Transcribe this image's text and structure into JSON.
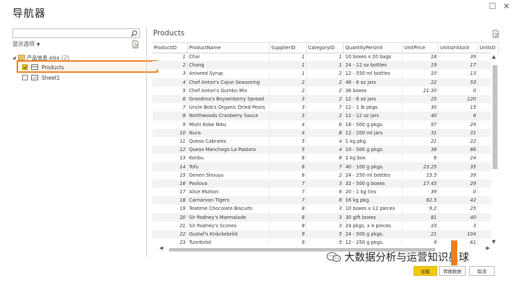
{
  "title": "导航器",
  "window_controls": {
    "maximize": "☐",
    "close": "✕"
  },
  "search": {
    "placeholder": "",
    "value": ""
  },
  "display_options": "显示选项",
  "tree": {
    "root_name": "产品信息.xlsx",
    "root_count": "[2]",
    "items": [
      {
        "label": "Products",
        "checked": true
      },
      {
        "label": "Sheet1",
        "checked": false
      }
    ]
  },
  "preview": {
    "title": "Products",
    "columns": [
      "ProductID",
      "ProductName",
      "SupplierID",
      "CategoryID",
      "QuantityPerUnit",
      "UnitPrice",
      "UnitsInStock",
      "UnitsO"
    ],
    "rows": [
      [
        "1",
        "Chai",
        "1",
        "1",
        "10 boxes x 20 bags",
        "18",
        "39"
      ],
      [
        "2",
        "Chang",
        "1",
        "1",
        "24 - 12 oz bottles",
        "19",
        "17"
      ],
      [
        "3",
        "Aniseed Syrup",
        "1",
        "2",
        "12 - 550 ml bottles",
        "10",
        "13"
      ],
      [
        "4",
        "Chef Anton's Cajun Seasoning",
        "2",
        "2",
        "48 - 6 oz jars",
        "22",
        "53"
      ],
      [
        "5",
        "Chef Anton's Gumbo Mix",
        "2",
        "2",
        "36 boxes",
        "21.35",
        "0"
      ],
      [
        "6",
        "Grandma's Boysenberry Spread",
        "3",
        "2",
        "12 - 8 oz jars",
        "25",
        "120"
      ],
      [
        "7",
        "Uncle Bob's Organic Dried Pears",
        "3",
        "7",
        "12 - 1 lb pkgs.",
        "30",
        "15"
      ],
      [
        "8",
        "Northwoods Cranberry Sauce",
        "3",
        "2",
        "12 - 12 oz jars",
        "40",
        "6"
      ],
      [
        "9",
        "Mishi Kobe Niku",
        "4",
        "6",
        "18 - 500 g pkgs.",
        "97",
        "29"
      ],
      [
        "10",
        "Ikura",
        "4",
        "8",
        "12 - 200 ml jars",
        "31",
        "31"
      ],
      [
        "11",
        "Queso Cabrales",
        "5",
        "4",
        "1 kg pkg.",
        "21",
        "22"
      ],
      [
        "12",
        "Queso Manchego La Pastora",
        "5",
        "4",
        "10 - 500 g pkgs.",
        "38",
        "86"
      ],
      [
        "13",
        "Konbu",
        "6",
        "8",
        "2 kg box",
        "6",
        "24"
      ],
      [
        "14",
        "Tofu",
        "6",
        "7",
        "40 - 100 g pkgs.",
        "23.25",
        "35"
      ],
      [
        "15",
        "Genen Shouyu",
        "6",
        "2",
        "24 - 250 ml bottles",
        "15.5",
        "39"
      ],
      [
        "16",
        "Pavlova",
        "7",
        "3",
        "32 - 500 g boxes",
        "17.45",
        "29"
      ],
      [
        "17",
        "Alice Mutton",
        "7",
        "6",
        "20 - 1 kg tins",
        "39",
        "0"
      ],
      [
        "18",
        "Carnarvon Tigers",
        "7",
        "8",
        "16 kg pkg.",
        "62.5",
        "42"
      ],
      [
        "19",
        "Teatime Chocolate Biscuits",
        "8",
        "3",
        "10 boxes x 12 pieces",
        "9.2",
        "25"
      ],
      [
        "20",
        "Sir Rodney's Marmalade",
        "8",
        "3",
        "30 gift boxes",
        "81",
        "40"
      ],
      [
        "21",
        "Sir Rodney's Scones",
        "8",
        "3",
        "24 pkgs. x 4 pieces",
        "10",
        "3"
      ],
      [
        "22",
        "Gustaf's Knäckebröd",
        "9",
        "5",
        "24 - 500 g pkgs.",
        "21",
        "104"
      ],
      [
        "23",
        "Tunnbröd",
        "9",
        "5",
        "12 - 250 g pkgs.",
        "9",
        "61"
      ]
    ]
  },
  "buttons": {
    "load": "加载",
    "transform": "转换数据",
    "cancel": "取消"
  },
  "watermark": "大数据分析与运营知识星球",
  "colors": {
    "highlight": "#ef7d1a",
    "load_button": "#f2c811"
  }
}
